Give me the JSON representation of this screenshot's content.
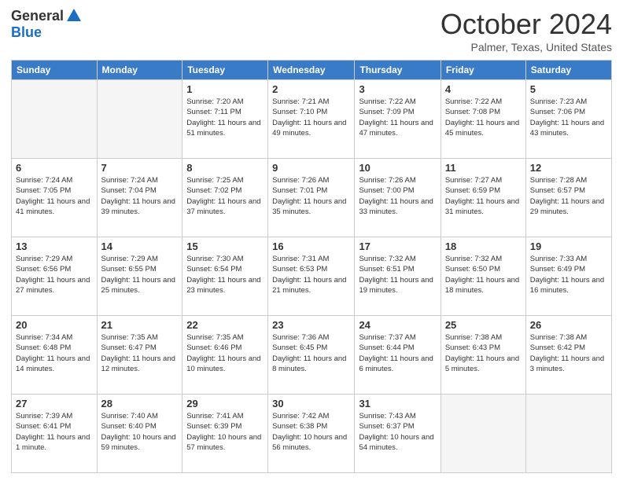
{
  "logo": {
    "general": "General",
    "blue": "Blue"
  },
  "title": "October 2024",
  "location": "Palmer, Texas, United States",
  "days_of_week": [
    "Sunday",
    "Monday",
    "Tuesday",
    "Wednesday",
    "Thursday",
    "Friday",
    "Saturday"
  ],
  "weeks": [
    [
      {
        "day": "",
        "info": ""
      },
      {
        "day": "",
        "info": ""
      },
      {
        "day": "1",
        "info": "Sunrise: 7:20 AM\nSunset: 7:11 PM\nDaylight: 11 hours and 51 minutes."
      },
      {
        "day": "2",
        "info": "Sunrise: 7:21 AM\nSunset: 7:10 PM\nDaylight: 11 hours and 49 minutes."
      },
      {
        "day": "3",
        "info": "Sunrise: 7:22 AM\nSunset: 7:09 PM\nDaylight: 11 hours and 47 minutes."
      },
      {
        "day": "4",
        "info": "Sunrise: 7:22 AM\nSunset: 7:08 PM\nDaylight: 11 hours and 45 minutes."
      },
      {
        "day": "5",
        "info": "Sunrise: 7:23 AM\nSunset: 7:06 PM\nDaylight: 11 hours and 43 minutes."
      }
    ],
    [
      {
        "day": "6",
        "info": "Sunrise: 7:24 AM\nSunset: 7:05 PM\nDaylight: 11 hours and 41 minutes."
      },
      {
        "day": "7",
        "info": "Sunrise: 7:24 AM\nSunset: 7:04 PM\nDaylight: 11 hours and 39 minutes."
      },
      {
        "day": "8",
        "info": "Sunrise: 7:25 AM\nSunset: 7:02 PM\nDaylight: 11 hours and 37 minutes."
      },
      {
        "day": "9",
        "info": "Sunrise: 7:26 AM\nSunset: 7:01 PM\nDaylight: 11 hours and 35 minutes."
      },
      {
        "day": "10",
        "info": "Sunrise: 7:26 AM\nSunset: 7:00 PM\nDaylight: 11 hours and 33 minutes."
      },
      {
        "day": "11",
        "info": "Sunrise: 7:27 AM\nSunset: 6:59 PM\nDaylight: 11 hours and 31 minutes."
      },
      {
        "day": "12",
        "info": "Sunrise: 7:28 AM\nSunset: 6:57 PM\nDaylight: 11 hours and 29 minutes."
      }
    ],
    [
      {
        "day": "13",
        "info": "Sunrise: 7:29 AM\nSunset: 6:56 PM\nDaylight: 11 hours and 27 minutes."
      },
      {
        "day": "14",
        "info": "Sunrise: 7:29 AM\nSunset: 6:55 PM\nDaylight: 11 hours and 25 minutes."
      },
      {
        "day": "15",
        "info": "Sunrise: 7:30 AM\nSunset: 6:54 PM\nDaylight: 11 hours and 23 minutes."
      },
      {
        "day": "16",
        "info": "Sunrise: 7:31 AM\nSunset: 6:53 PM\nDaylight: 11 hours and 21 minutes."
      },
      {
        "day": "17",
        "info": "Sunrise: 7:32 AM\nSunset: 6:51 PM\nDaylight: 11 hours and 19 minutes."
      },
      {
        "day": "18",
        "info": "Sunrise: 7:32 AM\nSunset: 6:50 PM\nDaylight: 11 hours and 18 minutes."
      },
      {
        "day": "19",
        "info": "Sunrise: 7:33 AM\nSunset: 6:49 PM\nDaylight: 11 hours and 16 minutes."
      }
    ],
    [
      {
        "day": "20",
        "info": "Sunrise: 7:34 AM\nSunset: 6:48 PM\nDaylight: 11 hours and 14 minutes."
      },
      {
        "day": "21",
        "info": "Sunrise: 7:35 AM\nSunset: 6:47 PM\nDaylight: 11 hours and 12 minutes."
      },
      {
        "day": "22",
        "info": "Sunrise: 7:35 AM\nSunset: 6:46 PM\nDaylight: 11 hours and 10 minutes."
      },
      {
        "day": "23",
        "info": "Sunrise: 7:36 AM\nSunset: 6:45 PM\nDaylight: 11 hours and 8 minutes."
      },
      {
        "day": "24",
        "info": "Sunrise: 7:37 AM\nSunset: 6:44 PM\nDaylight: 11 hours and 6 minutes."
      },
      {
        "day": "25",
        "info": "Sunrise: 7:38 AM\nSunset: 6:43 PM\nDaylight: 11 hours and 5 minutes."
      },
      {
        "day": "26",
        "info": "Sunrise: 7:38 AM\nSunset: 6:42 PM\nDaylight: 11 hours and 3 minutes."
      }
    ],
    [
      {
        "day": "27",
        "info": "Sunrise: 7:39 AM\nSunset: 6:41 PM\nDaylight: 11 hours and 1 minute."
      },
      {
        "day": "28",
        "info": "Sunrise: 7:40 AM\nSunset: 6:40 PM\nDaylight: 10 hours and 59 minutes."
      },
      {
        "day": "29",
        "info": "Sunrise: 7:41 AM\nSunset: 6:39 PM\nDaylight: 10 hours and 57 minutes."
      },
      {
        "day": "30",
        "info": "Sunrise: 7:42 AM\nSunset: 6:38 PM\nDaylight: 10 hours and 56 minutes."
      },
      {
        "day": "31",
        "info": "Sunrise: 7:43 AM\nSunset: 6:37 PM\nDaylight: 10 hours and 54 minutes."
      },
      {
        "day": "",
        "info": ""
      },
      {
        "day": "",
        "info": ""
      }
    ]
  ]
}
